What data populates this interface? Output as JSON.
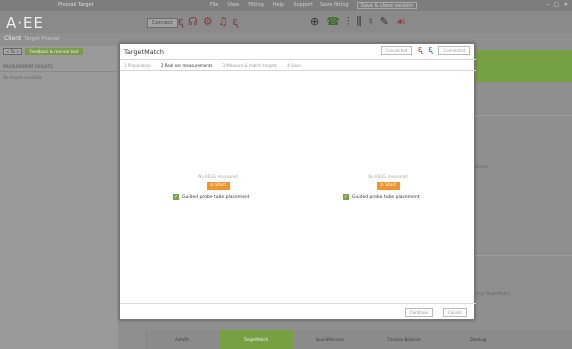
{
  "titlebar": {
    "app": "Phonak Target",
    "menus": [
      "File",
      "View",
      "Fitting",
      "Help",
      "Support"
    ],
    "right": [
      "Save fitting",
      "Save & close session"
    ],
    "button": "Save & close session"
  },
  "toolbar": {
    "logo": "A·EE",
    "connect": "Connect"
  },
  "sidebar": {
    "client_label": "Client",
    "client_name": "Target Phonak",
    "nav_btn": "< To >",
    "feedback": "Feedback & real ear test",
    "section": "MEASUREMENT RESULTS",
    "note": "No results available"
  },
  "dialog": {
    "title": "TargetMatch",
    "status_left": "Connected",
    "status_right": "Connected",
    "steps": [
      "1 Preparation",
      "2 Real ear measurements",
      "3 Measure & match targets",
      "4 Save"
    ],
    "left": {
      "msg": "No REUG measured",
      "start": "Start",
      "check": "Guided probe tube placement"
    },
    "right": {
      "msg": "No REUG measured",
      "start": "Start",
      "check": "Guided probe tube placement"
    },
    "continue": "Continue",
    "cancel": "Cancel"
  },
  "side": {
    "text1": "rement",
    "text2": "ed by TargetMatch"
  },
  "bottom_tabs": [
    "AutoFit",
    "TargetMatch",
    "SoundRecover",
    "Tinnitus Balance",
    "DataLog"
  ],
  "colors": {
    "accent": "#77a043",
    "start": "#f0952c"
  }
}
